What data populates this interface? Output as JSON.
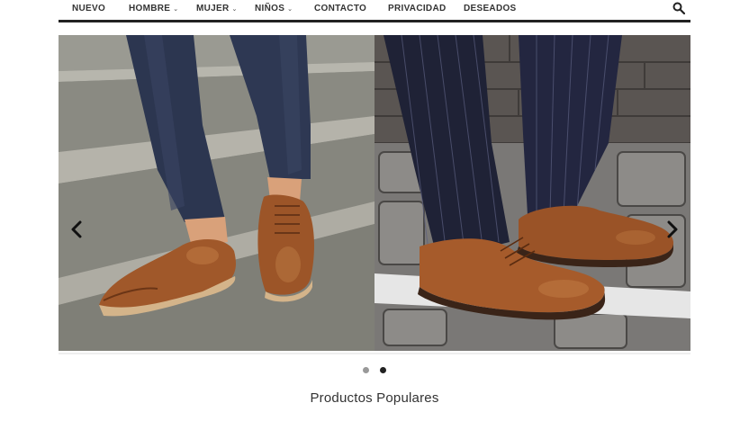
{
  "nav": {
    "items": [
      {
        "label": "NUEVO",
        "has_dropdown": false
      },
      {
        "label": "HOMBRE",
        "has_dropdown": true
      },
      {
        "label": "MUJER",
        "has_dropdown": true
      },
      {
        "label": "NIÑOS",
        "has_dropdown": true
      },
      {
        "label": "CONTACTO",
        "has_dropdown": false
      },
      {
        "label": "PRIVACIDAD",
        "has_dropdown": false
      },
      {
        "label": "DESEADOS",
        "has_dropdown": false
      }
    ],
    "search_icon": "search-icon",
    "dropdown_icon": "chevron-down-icon"
  },
  "slider": {
    "prev_icon": "chevron-left-icon",
    "next_icon": "chevron-right-icon",
    "slides": [
      "slide-1",
      "slide-2"
    ],
    "active_index": 1
  },
  "colors": {
    "nav_border": "#222222",
    "dot_inactive": "#999999",
    "dot_active": "#222222",
    "leather": "#a0582a"
  },
  "section": {
    "title": "Productos Populares"
  }
}
